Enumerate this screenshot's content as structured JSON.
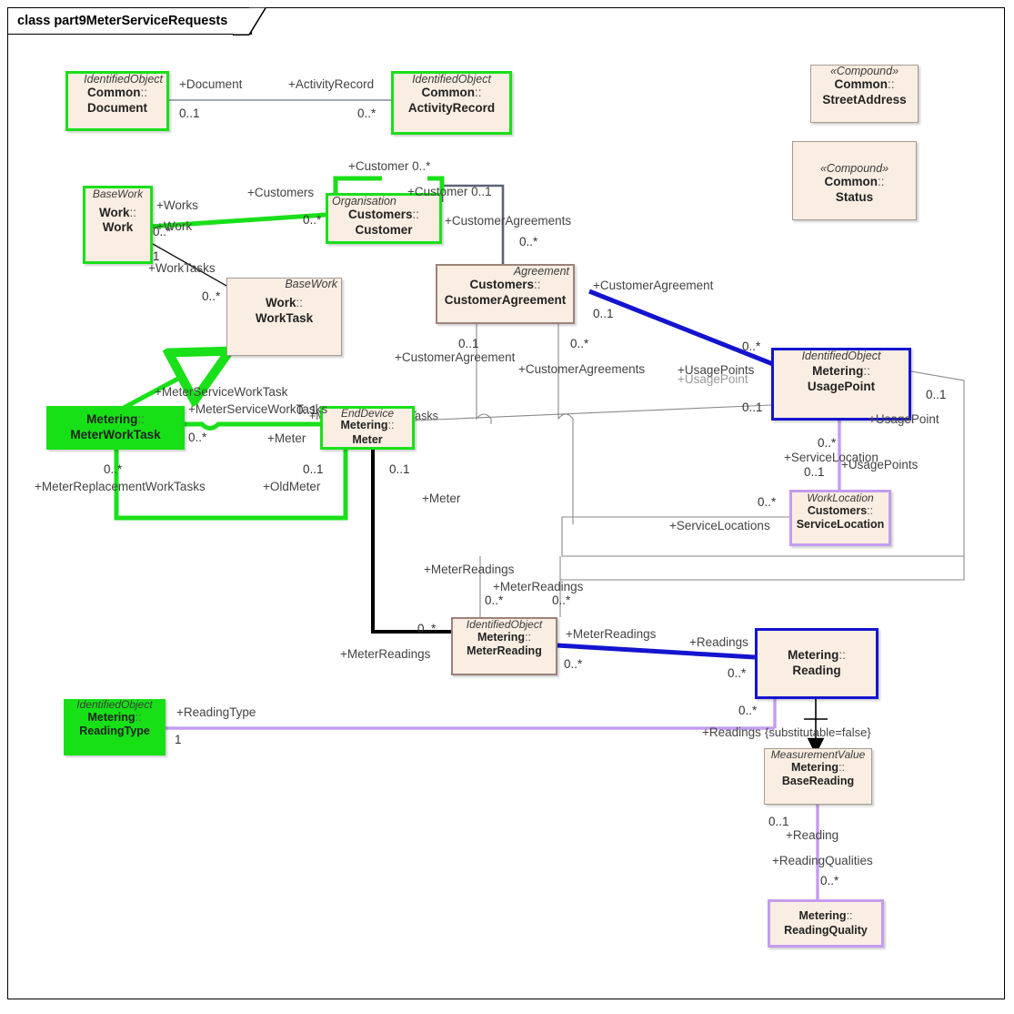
{
  "diagram": {
    "frame_label": "class part9MeterServiceRequests",
    "kind": "UML class diagram"
  },
  "colors": {
    "node_fill": "#faeee2",
    "highlight_green": "#19e019",
    "solid_green_fill": "#17e017",
    "blue": "#1414cf",
    "purple": "#c49df0",
    "brown": "#9d8278",
    "gray": "#a59a92",
    "line_gray": "#8a8a8a",
    "line_slate": "#5a6476",
    "line_black": "#000000"
  },
  "nodes": [
    {
      "id": "document",
      "stereotype": "IdentifiedObject",
      "ns": "Common",
      "name": "Document",
      "style": "b-green"
    },
    {
      "id": "activityrecord",
      "stereotype": "IdentifiedObject",
      "ns": "Common",
      "name": "ActivityRecord",
      "style": "b-green"
    },
    {
      "id": "streetaddress",
      "stereotype": "«Compound»",
      "ns": "Common",
      "name": "StreetAddress",
      "style": "b-gray"
    },
    {
      "id": "status",
      "stereotype": "«Compound»",
      "ns": "Common",
      "name": "Status",
      "style": "b-gray"
    },
    {
      "id": "work",
      "stereotype": "BaseWork",
      "ns": "Work",
      "name": "Work",
      "style": "b-green"
    },
    {
      "id": "customer",
      "stereotype": "Organisation",
      "ns": "Customers",
      "name": "Customer",
      "style": "b-green"
    },
    {
      "id": "worktask",
      "stereotype": "BaseWork",
      "ns": "Work",
      "name": "WorkTask",
      "style": "b-gray"
    },
    {
      "id": "customeragreement",
      "stereotype": "Agreement",
      "ns": "Customers",
      "name": "CustomerAgreement",
      "style": "b-brown"
    },
    {
      "id": "usagepoint",
      "stereotype": "IdentifiedObject",
      "ns": "Metering",
      "name": "UsagePoint",
      "style": "b-blue"
    },
    {
      "id": "servicelocation",
      "stereotype": "WorkLocation",
      "ns": "Customers",
      "name": "ServiceLocation",
      "style": "b-purple"
    },
    {
      "id": "meterworktask",
      "stereotype": "",
      "ns": "Metering",
      "name": "MeterWorkTask",
      "style": "fill-green"
    },
    {
      "id": "meter",
      "stereotype": "EndDevice",
      "ns": "Metering",
      "name": "Meter",
      "style": "b-green"
    },
    {
      "id": "meterreading",
      "stereotype": "IdentifiedObject",
      "ns": "Metering",
      "name": "MeterReading",
      "style": "b-brown"
    },
    {
      "id": "reading",
      "stereotype": "",
      "ns": "Metering",
      "name": "Reading",
      "style": "b-blue"
    },
    {
      "id": "readingtype",
      "stereotype": "IdentifiedObject",
      "ns": "Metering",
      "name": "ReadingType",
      "style": "fill-green"
    },
    {
      "id": "basereading",
      "stereotype": "MeasurementValue",
      "ns": "Metering",
      "name": "BaseReading",
      "style": "b-gray"
    },
    {
      "id": "readingquality",
      "stereotype": "",
      "ns": "Metering",
      "name": "ReadingQuality",
      "style": "b-purple"
    }
  ],
  "labels": {
    "document_role": "+Document",
    "document_mult": "0..1",
    "activityrecord_role": "+ActivityRecord",
    "activityrecord_mult": "0..*",
    "works_role": "+Works",
    "works_mult": "0..*",
    "work_role": "+Work",
    "customers_role": "+Customers",
    "customers_mult": "0..*",
    "customer_role_top": "+Customer 0..*",
    "customer_role_right": "+Customer 0..1",
    "worktasks_role": "+WorkTasks",
    "worktasks_mult_one": "1",
    "worktasks_mult_many": "0..*",
    "customeragreements_role": "+CustomerAgreements",
    "customeragreements_mult": "0..*",
    "customeragreement_role": "+CustomerAgreement",
    "customeragreement_mult1": "0..1",
    "customeragreement_mult2": "0..*",
    "customeragreement_role_b": "+CustomerAgreement",
    "customeragreements_role_b": "+CustomerAgreements",
    "usagepoints_role": "+UsagePoints",
    "usagepoint_role_hidden": "+UsagePoint",
    "usagepoint_mult_left": "0..1",
    "usagepoint_mult_top": "0..*",
    "usagepoint_role_right": "+UsagePoint",
    "usagepoint_mult_right": "0..1",
    "servicelocation_role": "+ServiceLocation",
    "servicelocation_mult": "0..1",
    "usagepoints_role_b": "+UsagePoints",
    "usagepoints_mult_b": "0..*",
    "servicelocations_role": "+ServiceLocations",
    "servicelocations_mult": "0..*",
    "meterservice_role": "+MeterServiceWorkTask",
    "meterservice_role_b": "+MeterServiceWorkTasks",
    "meterservice_mult": "0..*",
    "meter_role": "+Meter",
    "meter_mult_a": "0..1",
    "meter_mult_b": "0..1",
    "meter_role_b": "+Meter",
    "oldmeter_role": "+OldMeter",
    "oldmeter_mult": "0..1",
    "meterreplacement_role": "+MeterReplacementWorkTasks",
    "meterreplacement_mult": "0..*",
    "meterreadings_role_a": "+MeterReadings",
    "meterreadings_mult_a": "0..*",
    "meterreadings_role_b": "+MeterReadings",
    "meterreadings_mult_b": "0..*",
    "meterreadings_role_c": "+MeterReadings",
    "meterreadings_mult_c": "0..*",
    "meterreadings_role_d": "+MeterReadings",
    "meterreadings_mult_d": "0..*",
    "readings_role": "+Readings",
    "readings_mult": "0..*",
    "readings_role_b": "+Readings",
    "readings_mult_b": "0..*",
    "readingtype_role": "+ReadingType",
    "readingtype_mult": "1",
    "substitutable_note": "{substitutable=false}",
    "reading_role": "+Reading",
    "reading_mult": "0..1",
    "readingqualities_role": "+ReadingQualities",
    "readingqualities_mult": "0..*"
  }
}
